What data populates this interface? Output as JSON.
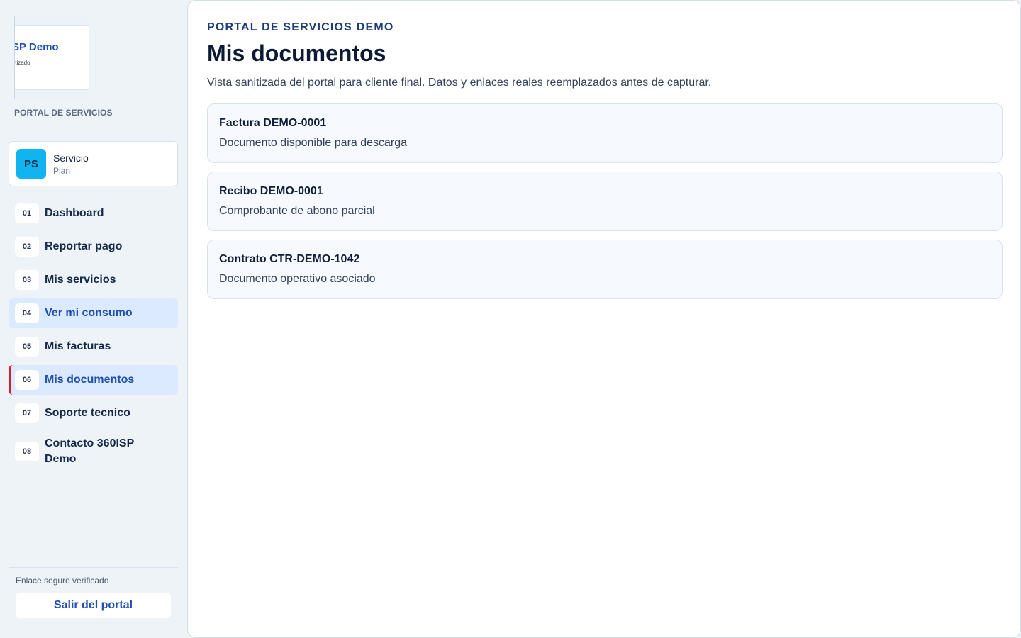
{
  "sidebar": {
    "logo": {
      "title": "SP Demo",
      "subtitle": "nitizado"
    },
    "brand_caption": "PORTAL DE SERVICIOS",
    "plan": {
      "avatar": "PS",
      "name": "Servicio",
      "sub": "Plan"
    },
    "nav": [
      {
        "num": "01",
        "label": "Dashboard"
      },
      {
        "num": "02",
        "label": "Reportar pago"
      },
      {
        "num": "03",
        "label": "Mis servicios"
      },
      {
        "num": "04",
        "label": "Ver mi consumo",
        "state": "highlighted"
      },
      {
        "num": "05",
        "label": "Mis facturas"
      },
      {
        "num": "06",
        "label": "Mis documentos",
        "state": "current"
      },
      {
        "num": "07",
        "label": "Soporte tecnico"
      },
      {
        "num": "08",
        "label": "Contacto 360ISP Demo"
      }
    ],
    "secure_text": "Enlace seguro verificado",
    "logout_label": "Salir del portal"
  },
  "main": {
    "eyebrow": "PORTAL DE SERVICIOS DEMO",
    "title": "Mis documentos",
    "subtitle": "Vista sanitizada del portal para cliente final. Datos y enlaces reales reemplazados antes de capturar.",
    "documents": [
      {
        "title": "Factura DEMO-0001",
        "description": "Documento disponible para descarga"
      },
      {
        "title": "Recibo DEMO-0001",
        "description": "Comprobante de abono parcial"
      },
      {
        "title": "Contrato CTR-DEMO-1042",
        "description": "Documento operativo asociado"
      }
    ]
  },
  "colors": {
    "accent": "#1e4fb0",
    "active_bg": "#dbeafe",
    "current_marker": "#d61f2c",
    "avatar_bg": "#10b4f0"
  }
}
